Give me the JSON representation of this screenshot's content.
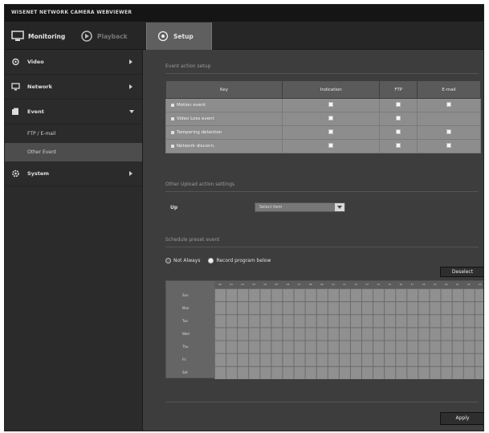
{
  "window": {
    "title": "WISENET NETWORK CAMERA WEBVIEWER"
  },
  "nav": {
    "tabs": [
      {
        "label": "Monitoring",
        "icon": "monitor-icon"
      },
      {
        "label": "Playback",
        "icon": "playback-icon"
      },
      {
        "label": "Setup",
        "icon": "setup-icon"
      }
    ],
    "active": "Setup"
  },
  "sidebar": {
    "items": [
      {
        "label": "Video",
        "icon": "camera-icon",
        "expanded": false
      },
      {
        "label": "Network",
        "icon": "network-icon",
        "expanded": false
      },
      {
        "label": "Event",
        "icon": "event-icon",
        "expanded": true,
        "children": [
          {
            "label": "FTP / E-mail"
          },
          {
            "label": "Other Event"
          }
        ]
      },
      {
        "label": "System",
        "icon": "gear-icon",
        "expanded": false
      }
    ],
    "active_child": "Other Event"
  },
  "event_section": {
    "title": "Event action setup",
    "columns": [
      "Key",
      "Indication",
      "FTP",
      "E-mail"
    ],
    "rows": [
      {
        "label": "Motion event",
        "checks": [
          true,
          true,
          true
        ]
      },
      {
        "label": "Video Loss event",
        "checks": [
          true,
          true,
          false
        ]
      },
      {
        "label": "Tampering detection",
        "checks": [
          true,
          true,
          true
        ]
      },
      {
        "label": "Network disconn.",
        "checks": [
          true,
          true,
          true
        ]
      }
    ]
  },
  "language_section": {
    "title": "Other Upload action settings",
    "field_label": "Up",
    "select_value": "Select item"
  },
  "schedule_section": {
    "title": "Schedule preset event",
    "options": [
      {
        "label": "Not Always",
        "selected": false
      },
      {
        "label": "Record program below",
        "selected": true
      }
    ],
    "toggle_button": "Deselect",
    "hours": [
      "00",
      "01",
      "02",
      "03",
      "04",
      "05",
      "06",
      "07",
      "08",
      "09",
      "10",
      "11",
      "12",
      "13",
      "14",
      "15",
      "16",
      "17",
      "18",
      "19",
      "20",
      "21",
      "22",
      "23"
    ],
    "days": [
      "Sun",
      "Mon",
      "Tue",
      "Wed",
      "Thu",
      "Fri",
      "Sat"
    ]
  },
  "footer": {
    "apply_label": "Apply"
  }
}
